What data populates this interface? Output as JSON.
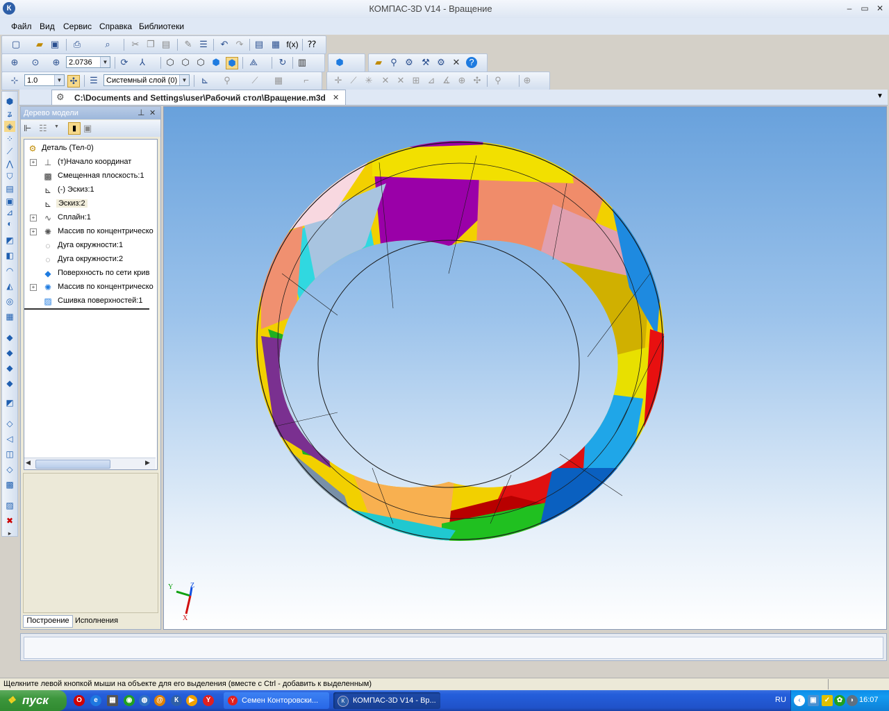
{
  "window": {
    "app_icon": "К",
    "title": "КОМПАС-3D V14 - Вращение",
    "minimize": "‒",
    "maximize": "▭",
    "close": "✕"
  },
  "menu": [
    "Файл",
    "Вид",
    "Сервис",
    "Справка",
    "Библиотеки"
  ],
  "toolbar": {
    "zoom_value": "2.0736",
    "step_value": "1.0",
    "layer_value": "Системный слой (0)"
  },
  "document": {
    "tab_title": "C:\\Documents and Settings\\user\\Рабочий стол\\Вращение.m3d",
    "tab_close": "✕",
    "tabs_menu": "▼"
  },
  "tree": {
    "header": "Дерево модели",
    "pin": "ᵩ",
    "close": "✕",
    "items": [
      {
        "label": "Деталь (Тел-0)",
        "icon": "part-icon"
      },
      {
        "label": "(т)Начало координат",
        "icon": "origin-icon"
      },
      {
        "label": "Смещенная плоскость:1",
        "icon": "plane-icon"
      },
      {
        "label": "(-) Эскиз:1",
        "icon": "sketch-icon"
      },
      {
        "label": "Эскиз:2",
        "icon": "sketch-icon"
      },
      {
        "label": "Сплайн:1",
        "icon": "spline-icon"
      },
      {
        "label": "Массив по концентрическо",
        "icon": "array-icon"
      },
      {
        "label": "Дуга окружности:1",
        "icon": "arc-icon"
      },
      {
        "label": "Дуга окружности:2",
        "icon": "arc-icon"
      },
      {
        "label": "Поверхность по сети крив",
        "icon": "surface-icon"
      },
      {
        "label": "Массив по концентрическо",
        "icon": "array-icon"
      },
      {
        "label": "Сшивка поверхностей:1",
        "icon": "stitch-icon"
      }
    ],
    "tabs": [
      "Построение",
      "Исполнения"
    ]
  },
  "axes": {
    "x": "X",
    "y": "Y",
    "z": "Z"
  },
  "status": {
    "hint": "Щелкните левой кнопкой мыши на объекте для его выделения (вместе с Ctrl - добавить к выделенным)"
  },
  "taskbar": {
    "start": "пуск",
    "tasks": [
      "Семен Конторовски...",
      "КОМПАС-3D V14 - Вр..."
    ],
    "lang": "RU",
    "clock": "16:07"
  },
  "colors": {
    "ring_yellow": "#f2e000",
    "ring_magenta": "#a000b0",
    "ring_salmon": "#f0906a",
    "ring_cyan": "#20d0e0",
    "ring_green": "#20c020",
    "ring_red": "#e01010",
    "ring_blue": "#1080e0",
    "ring_orange": "#f8b050",
    "ring_pink": "#e0a0b0",
    "ring_olive": "#d0b000"
  }
}
